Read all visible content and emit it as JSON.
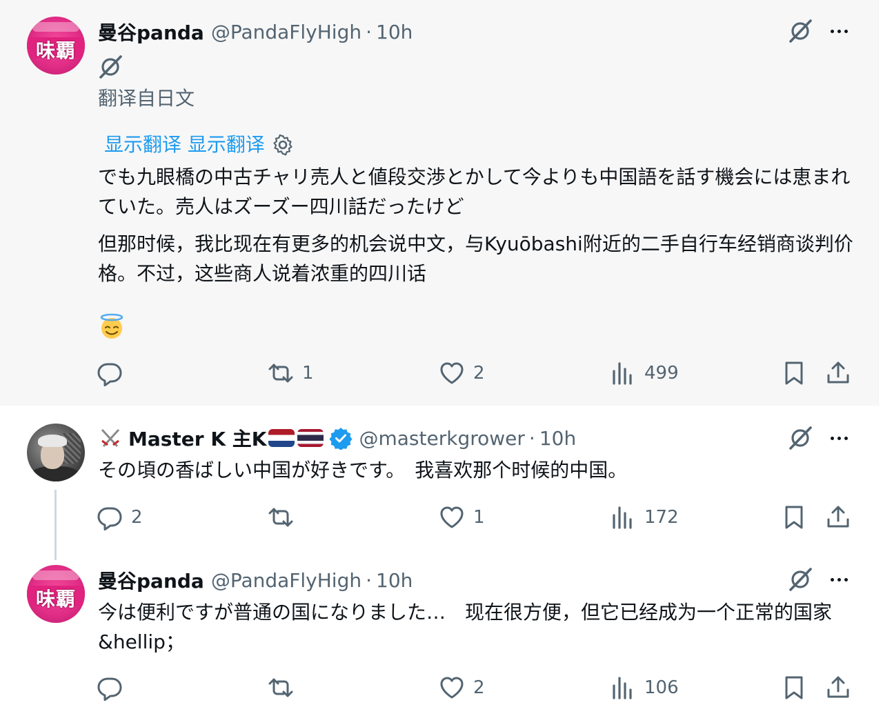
{
  "tweets": [
    {
      "display_name": "曼谷panda",
      "handle": "@PandaFlyHigh",
      "separator": "·",
      "time": "10h",
      "translated_from": "翻译自日文",
      "show_translation": "显示翻译 显示翻译",
      "original_text": "でも九眼橋の中古チャリ売人と値段交渉とかして今よりも中国語を話す機会には恵まれていた。売人はズーズー四川話だったけど",
      "translated_text": "但那时候，我比现在有更多的机会说中文，与Kyuōbashi附近的二手自行车经销商谈判价格。不过，这些商人说着浓重的四川话",
      "emoji": "smiling-face-with-halo",
      "actions": {
        "replies": "",
        "reposts": "1",
        "likes": "2",
        "views": "499"
      }
    },
    {
      "display_name": "Master K 主K",
      "handle": "@masterkgrower",
      "separator": "·",
      "time": "10h",
      "text": "その頃の香ばしい中国が好きです。　我喜欢那个时候的中国。",
      "verified": true,
      "actions": {
        "replies": "2",
        "reposts": "",
        "likes": "1",
        "views": "172"
      }
    },
    {
      "display_name": "曼谷panda",
      "handle": "@PandaFlyHigh",
      "separator": "·",
      "time": "10h",
      "text": "今は便利ですが普通の国になりました…　现在很方便，但它已经成为一个正常的国家&hellip；",
      "actions": {
        "replies": "",
        "reposts": "",
        "likes": "2",
        "views": "106"
      }
    }
  ],
  "avatar_glyph": "味覇",
  "colors": {
    "text": "#0f1419",
    "muted": "#536471",
    "link": "#1d9bf0",
    "verified": "#1d9bf0",
    "highlight_bg": "#f7f7f7"
  },
  "icons": [
    "grok-icon",
    "more-icon",
    "reply-icon",
    "repost-icon",
    "like-icon",
    "views-icon",
    "bookmark-icon",
    "share-icon",
    "gear-icon",
    "verified-badge-icon"
  ]
}
